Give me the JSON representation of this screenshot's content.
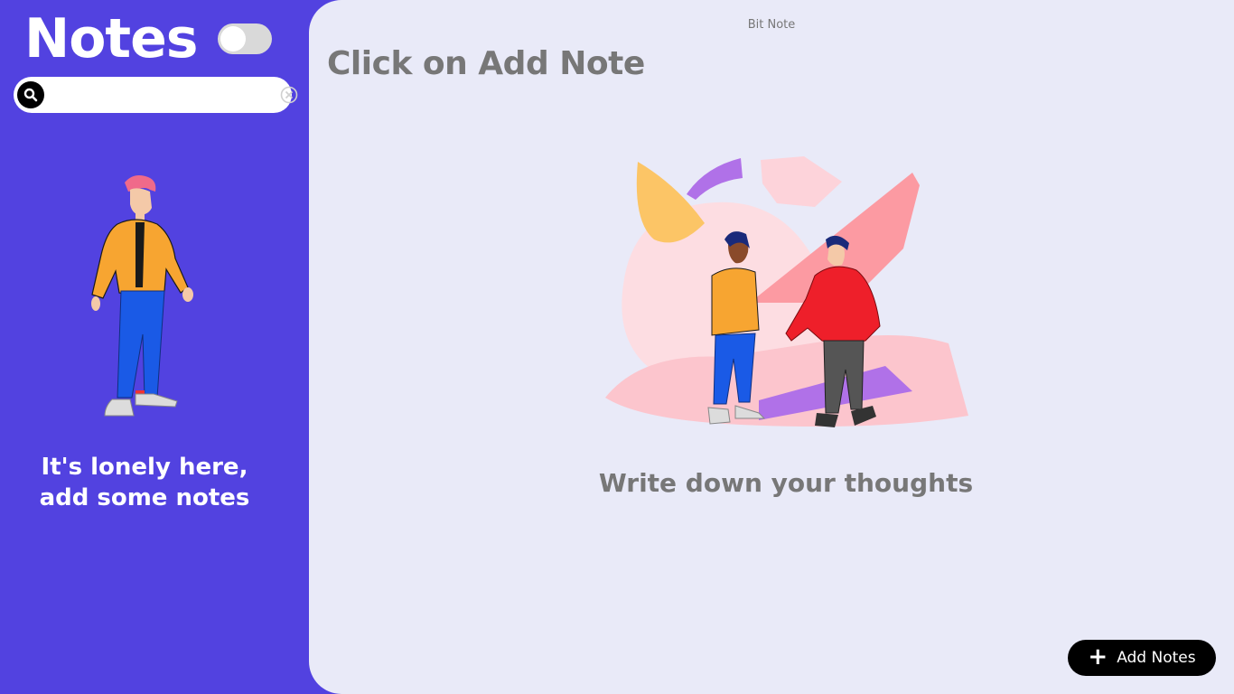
{
  "sidebar": {
    "title": "Notes",
    "theme_toggle": {
      "on": false
    },
    "search": {
      "value": "",
      "placeholder": ""
    },
    "empty_message_line1": "It's lonely here,",
    "empty_message_line2": "add some notes"
  },
  "main": {
    "brand": "Bit Note",
    "heading": "Click on Add Note",
    "caption": "Write down your thoughts"
  },
  "add_button": {
    "label": "Add Notes",
    "icon": "plus-icon"
  },
  "colors": {
    "sidebar_bg": "#5242e0",
    "main_bg": "#e9eaf8",
    "heading": "#777777",
    "button_bg": "#000000"
  }
}
